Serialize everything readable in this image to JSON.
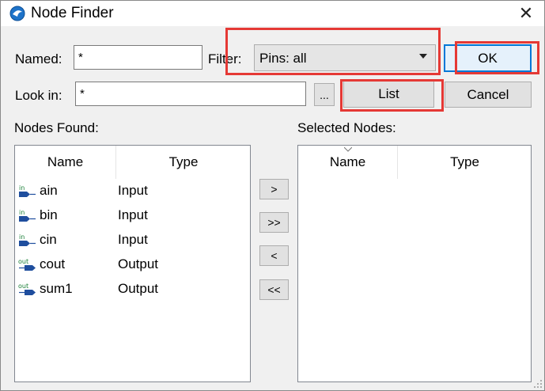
{
  "window": {
    "title": "Node Finder",
    "close_glyph": "✕"
  },
  "named": {
    "label": "Named:",
    "value": "*"
  },
  "filter": {
    "label": "Filter:",
    "selected": "Pins: all"
  },
  "look_in": {
    "label": "Look in:",
    "value": "*",
    "browse_label": "..."
  },
  "buttons": {
    "ok": "OK",
    "list": "List",
    "cancel": "Cancel"
  },
  "move_buttons": {
    "add": ">",
    "add_all": ">>",
    "remove": "<",
    "remove_all": "<<"
  },
  "nodes_found": {
    "label": "Nodes Found:",
    "columns": [
      "Name",
      "Type"
    ],
    "rows": [
      {
        "name": "ain",
        "type": "Input",
        "icon": "input-pin-icon"
      },
      {
        "name": "bin",
        "type": "Input",
        "icon": "input-pin-icon"
      },
      {
        "name": "cin",
        "type": "Input",
        "icon": "input-pin-icon"
      },
      {
        "name": "cout",
        "type": "Output",
        "icon": "output-pin-icon"
      },
      {
        "name": "sum1",
        "type": "Output",
        "icon": "output-pin-icon"
      }
    ]
  },
  "selected_nodes": {
    "label": "Selected Nodes:",
    "columns": [
      "Name",
      "Type"
    ],
    "rows": []
  },
  "icon_text": {
    "input": "in",
    "output": "out"
  },
  "colors": {
    "accent": "#0078d7",
    "highlight": "#e53935",
    "pin_input": "#1a7f37",
    "pin_output": "#1a7f37",
    "pin_body": "#1f4e9e"
  }
}
